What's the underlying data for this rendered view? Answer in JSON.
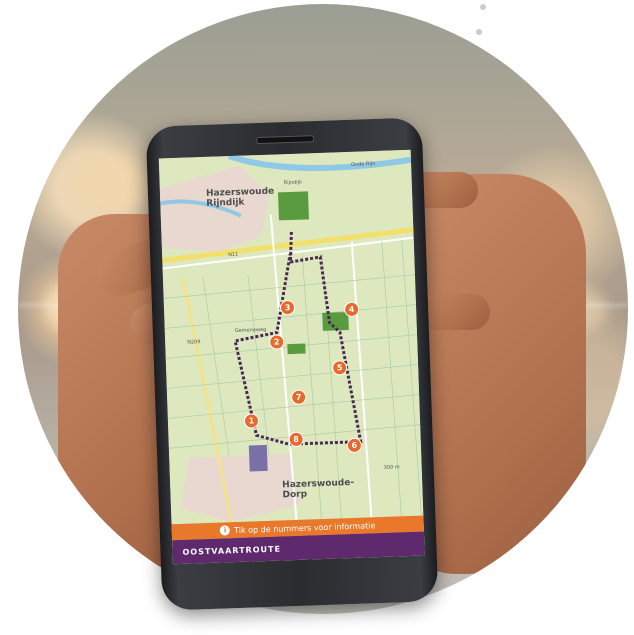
{
  "map": {
    "town_north": "Hazerswoude\nRijndijk",
    "town_south": "Hazerswoude-\nDorp",
    "road_top": "Oude Rijn",
    "road_name_1": "Rijndijk",
    "road_name_2": "N11",
    "road_name_3": "N209",
    "road_name_4": "Gemeneweg",
    "scale": "300 m"
  },
  "waypoints": [
    {
      "label": "1"
    },
    {
      "label": "2"
    },
    {
      "label": "3"
    },
    {
      "label": "4"
    },
    {
      "label": "5"
    },
    {
      "label": "6"
    },
    {
      "label": "7"
    },
    {
      "label": "8"
    }
  ],
  "info_bar": {
    "number": "i",
    "text": "Tik op de nummers voor informatie"
  },
  "brand": {
    "text": "OOSTVAARTROUTE"
  },
  "colors": {
    "route_accent": "#e8692c",
    "brand_bar": "#5e2a6d",
    "map_base": "#dfe9c1"
  }
}
